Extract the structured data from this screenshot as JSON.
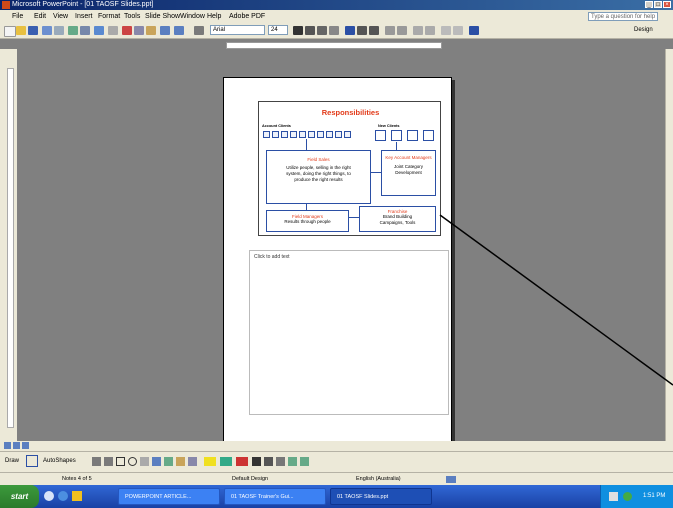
{
  "window": {
    "title": "Microsoft PowerPoint - [01 TAOSF Slides.ppt]",
    "controls": [
      "_",
      "□",
      "×"
    ]
  },
  "menu": {
    "items": [
      "File",
      "Edit",
      "View",
      "Insert",
      "Format",
      "Tools",
      "Slide Show",
      "Window",
      "Help",
      "Adobe PDF"
    ],
    "help_placeholder": "Type a question for help"
  },
  "toolbar": {
    "font": "Arial",
    "size": "24",
    "design_label": "Design"
  },
  "slide": {
    "title": "Responsibilities",
    "left_group_label": "Account Clients",
    "right_group_label": "New Clients",
    "center_box": {
      "title": "Field Sales",
      "text": "Utilize people, selling in the right\nsystem, doing the right things, to\nproduce the right results"
    },
    "right_box": {
      "title": "Key Account Managers",
      "text": "Joint Category\nDevelopment"
    },
    "bottom_left_box": {
      "title": "Field Managers",
      "text": "Results through people"
    },
    "bottom_right_box": {
      "title": "Franchise",
      "text": "Brand Building\nCampaigns, Tools"
    }
  },
  "notes": {
    "placeholder": "Click to add text"
  },
  "drawbar": {
    "draw_label": "Draw",
    "autoshapes_label": "AutoShapes"
  },
  "status": {
    "slide": "Notes 4 of 5",
    "design": "Default Design",
    "language": "English (Australia)"
  },
  "taskbar": {
    "start_label": "start",
    "tasks": [
      "POWERPOINT ARTICLE...",
      "01 TAOSF Trainer's Gui...",
      "01 TAOSF Slides.ppt"
    ],
    "clock": "1:51 PM"
  },
  "colors": {
    "accent_red": "#e23b1a",
    "box_blue": "#2b4fa5",
    "taskbar_blue": "#245edb"
  }
}
